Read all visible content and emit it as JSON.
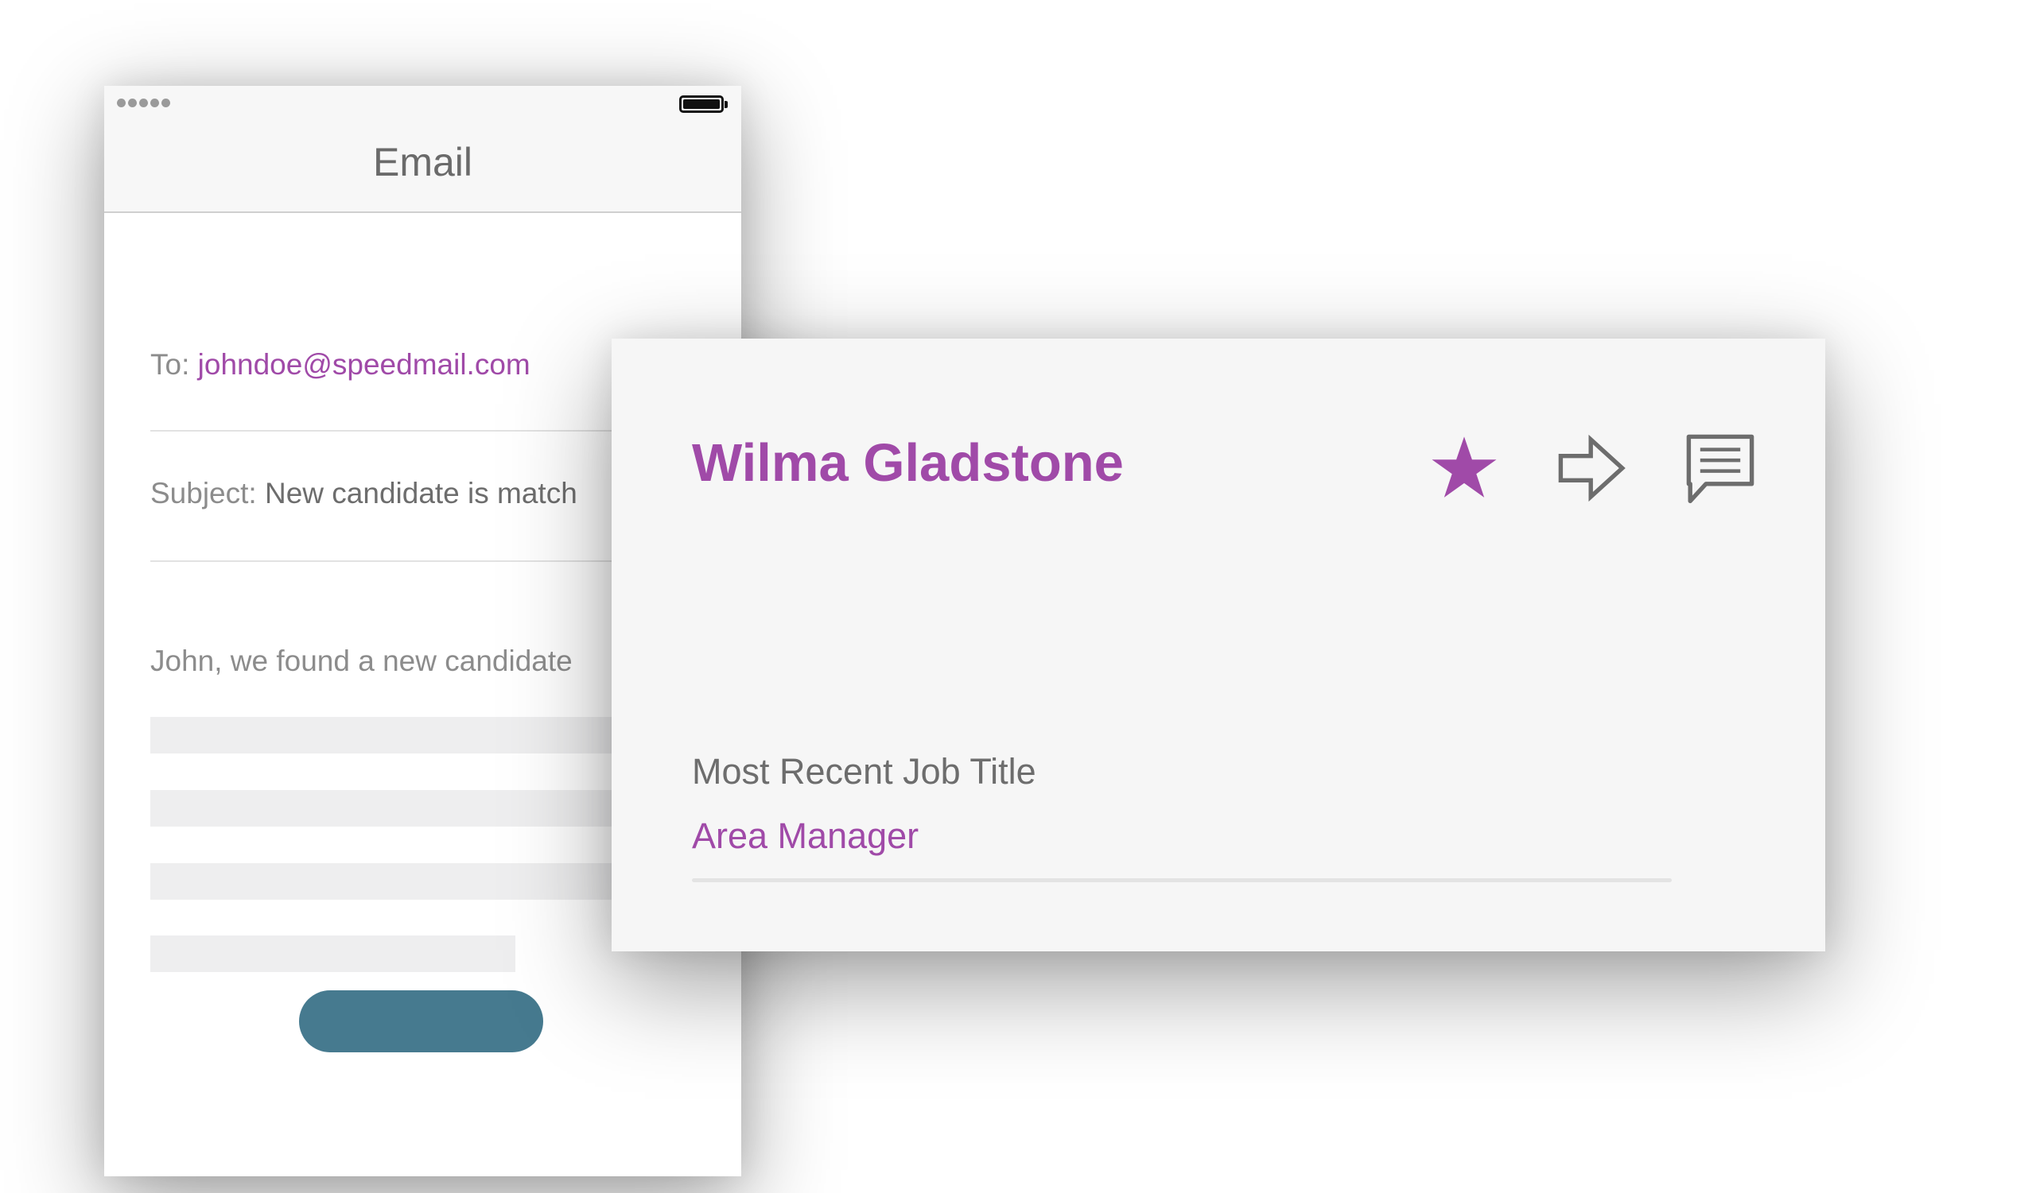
{
  "email_app": {
    "title": "Email",
    "to_label": "To: ",
    "to_value": "johndoe@speedmail.com",
    "subject_label": "Subject: ",
    "subject_value": "New candidate is match",
    "body_preview": "John, we found a new candidate",
    "colors": {
      "accent": "#a04aa8",
      "button": "#467a8f"
    }
  },
  "candidate_card": {
    "name": "Wilma Gladstone",
    "icons": [
      "star-icon",
      "forward-arrow-icon",
      "message-icon"
    ],
    "job_title_label": "Most Recent Job Title",
    "job_title_value": "Area Manager",
    "colors": {
      "accent": "#a04aa8",
      "icon_outline": "#6d6d6d"
    }
  }
}
